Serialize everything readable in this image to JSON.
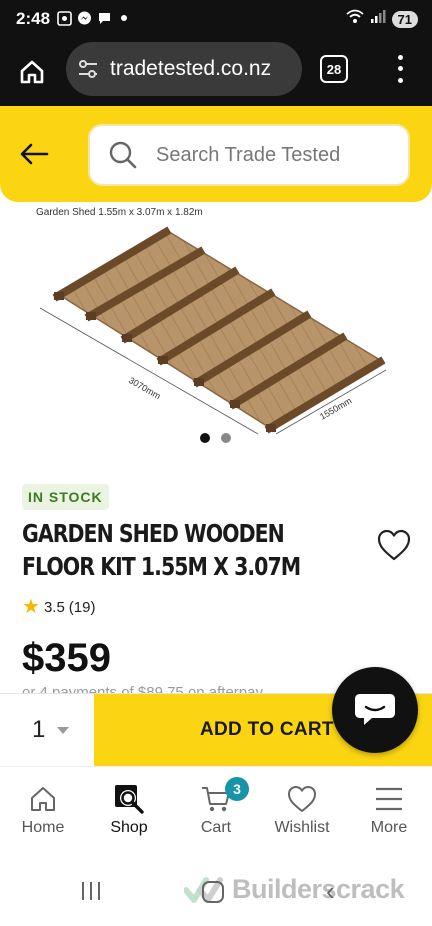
{
  "status": {
    "time": "2:48",
    "battery": "71"
  },
  "browser": {
    "url": "tradetested.co.nz",
    "tab_count": "28"
  },
  "search": {
    "placeholder": "Search Trade Tested"
  },
  "gallery": {
    "caption": "Garden Shed 1.55m  x 3.07m  x 1.82m",
    "dimension_length": "3070mm",
    "dimension_width": "1550mm",
    "slides_total": 2,
    "active_slide": 1
  },
  "product": {
    "stock_badge": "IN STOCK",
    "title": "GARDEN SHED WOODEN FLOOR KIT 1.55M X 3.07M",
    "rating": "3.5",
    "review_count": "(19)",
    "price": "$359",
    "afterpay_text": "or 4 payments of $89.75 on afterpay"
  },
  "cart_bar": {
    "quantity": "1",
    "add_to_cart_label": "ADD TO CART"
  },
  "bottom_nav": {
    "items": [
      {
        "label": "Home",
        "icon": "home-icon"
      },
      {
        "label": "Shop",
        "icon": "shop-icon"
      },
      {
        "label": "Cart",
        "icon": "cart-icon",
        "badge": "3"
      },
      {
        "label": "Wishlist",
        "icon": "heart-icon"
      },
      {
        "label": "More",
        "icon": "hamburger-icon"
      }
    ],
    "active": "Shop"
  },
  "watermark": {
    "text": "Builderscrack"
  },
  "colors": {
    "brand_yellow": "#fbd512",
    "badge_teal": "#1794a8",
    "stock_green": "#3d7a25"
  }
}
